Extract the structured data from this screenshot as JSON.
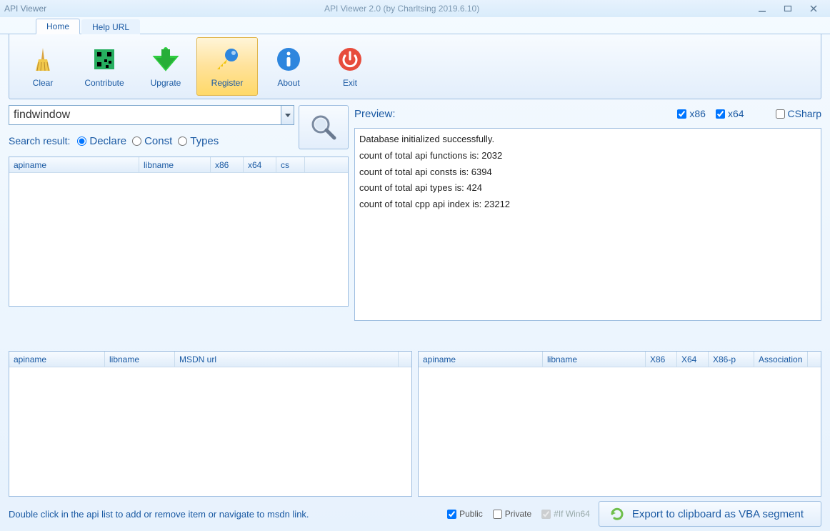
{
  "titlebar": {
    "app": "API Viewer",
    "subtitle": "API Viewer 2.0 (by Charltsing 2019.6.10)"
  },
  "tabs": {
    "home": "Home",
    "help": "Help URL"
  },
  "ribbon": {
    "clear": "Clear",
    "contribute": "Contribute",
    "upgrate": "Upgrate",
    "register": "Register",
    "about": "About",
    "exit": "Exit"
  },
  "search": {
    "value": "findwindow",
    "result_label": "Search result:",
    "radio_declare": "Declare",
    "radio_const": "Const",
    "radio_types": "Types"
  },
  "columns_top": {
    "apiname": "apiname",
    "libname": "libname",
    "x86": "x86",
    "x64": "x64",
    "cs": "cs"
  },
  "preview": {
    "label": "Preview:",
    "x86": "x86",
    "x64": "x64",
    "csharp": "CSharp",
    "lines": [
      "Database initialized successfully.",
      "count of total api functions is: 2032",
      "count of total api consts is: 6394",
      "count of total api types is: 424",
      "count of total cpp api index is: 23212"
    ]
  },
  "columns_bl": {
    "apiname": "apiname",
    "libname": "libname",
    "msdn": "MSDN url"
  },
  "columns_br": {
    "apiname": "apiname",
    "libname": "libname",
    "x86": "X86",
    "x64": "X64",
    "x86p": "X86-p",
    "assoc": "Association"
  },
  "status": {
    "hint": "Double click in the api list to add or remove item or navigate to msdn link.",
    "public": "Public",
    "private": "Private",
    "ifwin64": "#If Win64",
    "export": "Export to clipboard as VBA segment"
  }
}
